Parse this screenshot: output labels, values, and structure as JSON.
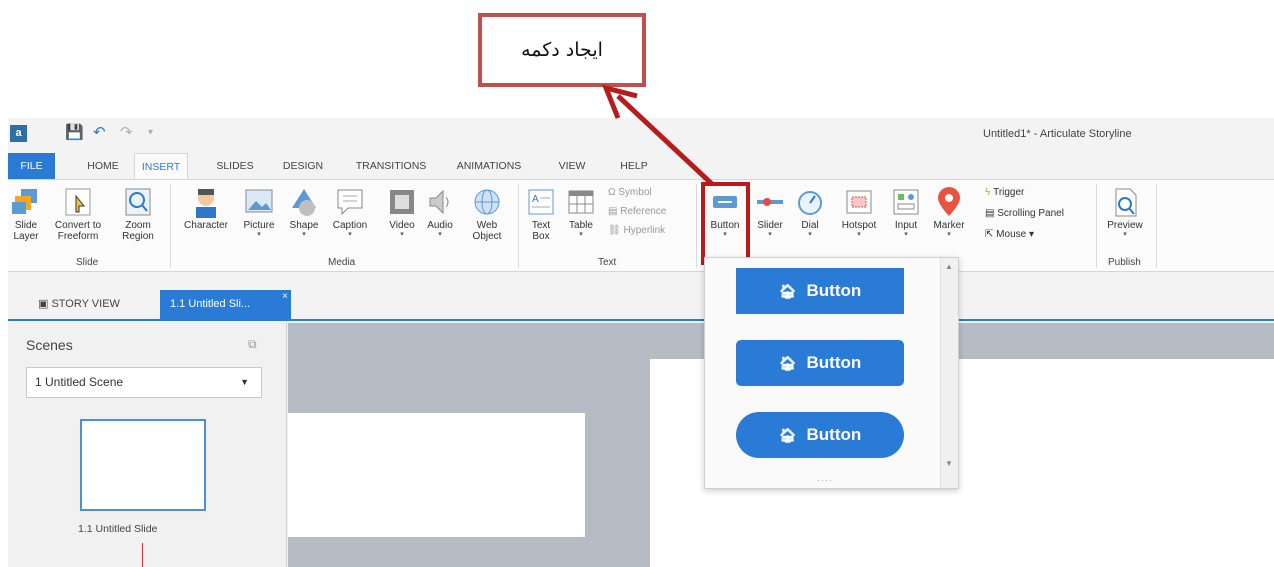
{
  "annotation": {
    "text": "ایجاد دکمه"
  },
  "window": {
    "title": "Untitled1* - Articulate Storyline",
    "app_icon": "storyline-logo-icon"
  },
  "quick_access": [
    "save-icon",
    "undo-icon",
    "redo-icon",
    "customize-icon"
  ],
  "menu_tabs": [
    "FILE",
    "HOME",
    "INSERT",
    "SLIDES",
    "DESIGN",
    "TRANSITIONS",
    "ANIMATIONS",
    "VIEW",
    "HELP"
  ],
  "active_tab": "INSERT",
  "ribbon": {
    "slide_group": {
      "label": "Slide",
      "slide_layer": [
        "Slide",
        "Layer"
      ],
      "convert": [
        "Convert to",
        "Freeform"
      ],
      "zoom": [
        "Zoom",
        "Region"
      ]
    },
    "media_group": {
      "label": "Media",
      "character": "Character",
      "picture": "Picture",
      "shape": "Shape",
      "caption": "Caption",
      "video": "Video",
      "audio": "Audio",
      "web_object": [
        "Web",
        "Object"
      ]
    },
    "text_group": {
      "label": "Text",
      "text_box": [
        "Text",
        "Box"
      ],
      "table": "Table",
      "symbol": "Symbol",
      "reference": "Reference",
      "hyperlink": "Hyperlink"
    },
    "interactive": {
      "button": "Button",
      "slider": "Slider",
      "dial": "Dial",
      "hotspot": "Hotspot",
      "input": "Input",
      "marker": "Marker",
      "trigger": "Trigger",
      "scrolling_panel": "Scrolling Panel",
      "mouse": "Mouse"
    },
    "publish_group": {
      "label": "Publish",
      "preview": "Preview"
    }
  },
  "doc_tabs": {
    "story_view": "STORY VIEW",
    "slide": "1.1 Untitled Sli..."
  },
  "scenes_panel": {
    "title": "Scenes",
    "selected_scene": "1 Untitled Scene",
    "thumbnail_label": "1.1 Untitled Slide"
  },
  "button_gallery": {
    "items": [
      "Button",
      "Button",
      "Button"
    ]
  },
  "colors": {
    "accent": "#2a7bd6",
    "annotation_border": "#c0504d",
    "highlight": "#b71c1c"
  }
}
